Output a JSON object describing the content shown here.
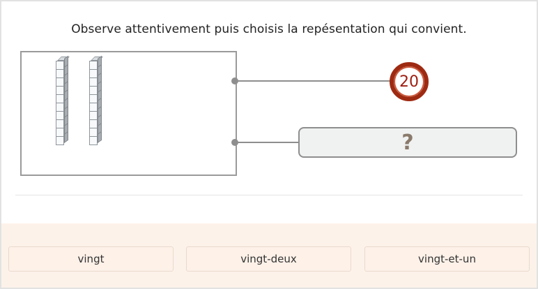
{
  "instruction": "Observe attentivement puis choisis la repésentation qui convient.",
  "representation": {
    "rods": 2,
    "cubes_per_rod": 10
  },
  "target_number": "20",
  "answer_slot": {
    "value": "?"
  },
  "choices": [
    {
      "label": "vingt"
    },
    {
      "label": "vingt-deux"
    },
    {
      "label": "vingt-et-un"
    }
  ],
  "colors": {
    "badge_ring": "#9e2a12",
    "badge_text": "#9e1d10",
    "choices_background": "#fdf2ea",
    "connector": "#8e8e8e"
  }
}
